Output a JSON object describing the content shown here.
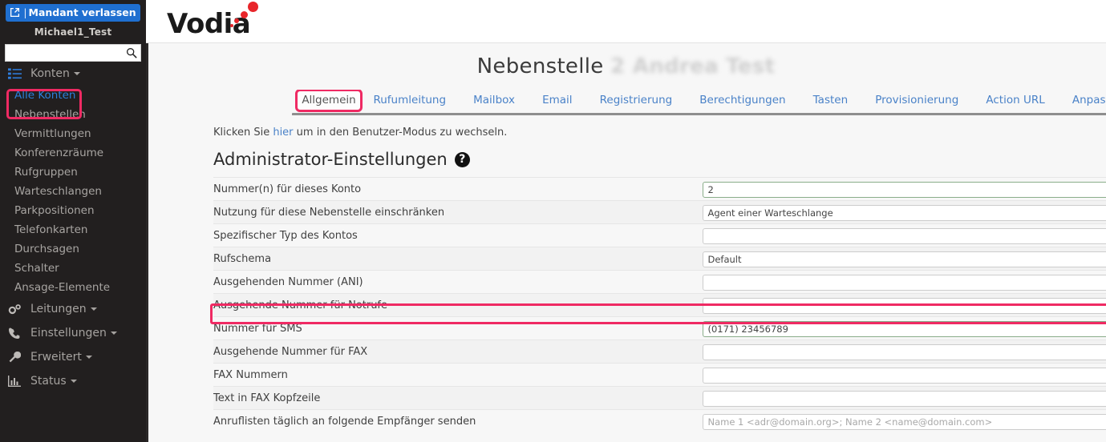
{
  "sidebar": {
    "tenant_button": {
      "label": "Mandant verlassen",
      "separator": "|",
      "icon": "external-link-icon"
    },
    "tenant_name": "Michael1_Test",
    "search": {
      "value": "",
      "placeholder": ""
    },
    "groups": [
      {
        "label": "Konten",
        "icon": "list-icon",
        "expanded": true,
        "items": [
          {
            "label": "Alle Konten",
            "active": true
          },
          {
            "label": "Nebenstellen",
            "active": false
          },
          {
            "label": "Vermittlungen",
            "active": false
          },
          {
            "label": "Konferenzräume",
            "active": false
          },
          {
            "label": "Rufgruppen",
            "active": false
          },
          {
            "label": "Warteschlangen",
            "active": false
          },
          {
            "label": "Parkpositionen",
            "active": false
          },
          {
            "label": "Telefonkarten",
            "active": false
          },
          {
            "label": "Durchsagen",
            "active": false
          },
          {
            "label": "Schalter",
            "active": false
          },
          {
            "label": "Ansage-Elemente",
            "active": false
          }
        ]
      },
      {
        "label": "Leitungen",
        "icon": "gears-icon",
        "expanded": false,
        "items": []
      },
      {
        "label": "Einstellungen",
        "icon": "phone-icon",
        "expanded": false,
        "items": []
      },
      {
        "label": "Erweitert",
        "icon": "wrench-icon",
        "expanded": false,
        "items": []
      },
      {
        "label": "Status",
        "icon": "bar-chart-icon",
        "expanded": false,
        "items": []
      }
    ]
  },
  "topbar": {
    "logo_text": "Vodia",
    "grid_icon": "calendar-grid-icon",
    "placeholder_box": "gray-panel",
    "logout_icon": "logout-icon"
  },
  "page": {
    "title_prefix": "Nebenstelle",
    "title_suffix": "2  Andrea Test"
  },
  "tabs": [
    {
      "label": "Allgemein",
      "active": true
    },
    {
      "label": "Rufumleitung",
      "active": false
    },
    {
      "label": "Mailbox",
      "active": false
    },
    {
      "label": "Email",
      "active": false
    },
    {
      "label": "Registrierung",
      "active": false
    },
    {
      "label": "Berechtigungen",
      "active": false
    },
    {
      "label": "Tasten",
      "active": false
    },
    {
      "label": "Provisionierung",
      "active": false
    },
    {
      "label": "Action URL",
      "active": false
    },
    {
      "label": "Anpas:",
      "active": false
    }
  ],
  "content": {
    "hint_before": "Klicken Sie ",
    "hint_link": "hier",
    "hint_after": " um in den Benutzer-Modus zu wechseln.",
    "section_title": "Administrator-Einstellungen",
    "help_glyph": "?",
    "rows": [
      {
        "label": "Nummer(n) für dieses Konto",
        "type": "text",
        "value": "2",
        "placeholder": "",
        "plus": true,
        "green": true,
        "highlight": false
      },
      {
        "label": "Nutzung für diese Nebenstelle einschränken",
        "type": "select",
        "value": "Agent einer Warteschlange",
        "placeholder": "",
        "plus": false,
        "green": false,
        "highlight": false
      },
      {
        "label": "Spezifischer Typ des Kontos",
        "type": "text",
        "value": "",
        "placeholder": "",
        "plus": false,
        "green": false,
        "highlight": false
      },
      {
        "label": "Rufschema",
        "type": "select",
        "value": "Default",
        "placeholder": "",
        "plus": false,
        "green": false,
        "highlight": false
      },
      {
        "label": "Ausgehenden Nummer (ANI)",
        "type": "text",
        "value": "",
        "placeholder": "",
        "plus": true,
        "green": false,
        "highlight": false
      },
      {
        "label": "Ausgehende Nummer für Notrufe",
        "type": "text",
        "value": "",
        "placeholder": "",
        "plus": true,
        "green": false,
        "highlight": false
      },
      {
        "label": "Nummer für SMS",
        "type": "text",
        "value": "(0171) 23456789",
        "placeholder": "",
        "plus": true,
        "green": true,
        "highlight": true
      },
      {
        "label": "Ausgehende Nummer für FAX",
        "type": "text",
        "value": "",
        "placeholder": "",
        "plus": true,
        "green": false,
        "highlight": false
      },
      {
        "label": "FAX Nummern",
        "type": "text",
        "value": "",
        "placeholder": "",
        "plus": true,
        "green": false,
        "highlight": false
      },
      {
        "label": "Text in FAX Kopfzeile",
        "type": "text",
        "value": "",
        "placeholder": "",
        "plus": false,
        "green": false,
        "highlight": false
      },
      {
        "label": "Anruflisten täglich an folgende Empfänger senden",
        "type": "text",
        "value": "",
        "placeholder": "Name 1 <adr@domain.org>; Name 2 <name@domain.com>",
        "plus": false,
        "green": false,
        "highlight": false
      }
    ]
  },
  "colors": {
    "accent_blue": "#2b7fdb",
    "highlight_pink": "#ef2a63",
    "sidebar_bg": "#221f1f",
    "logo_red": "#e8252a"
  }
}
